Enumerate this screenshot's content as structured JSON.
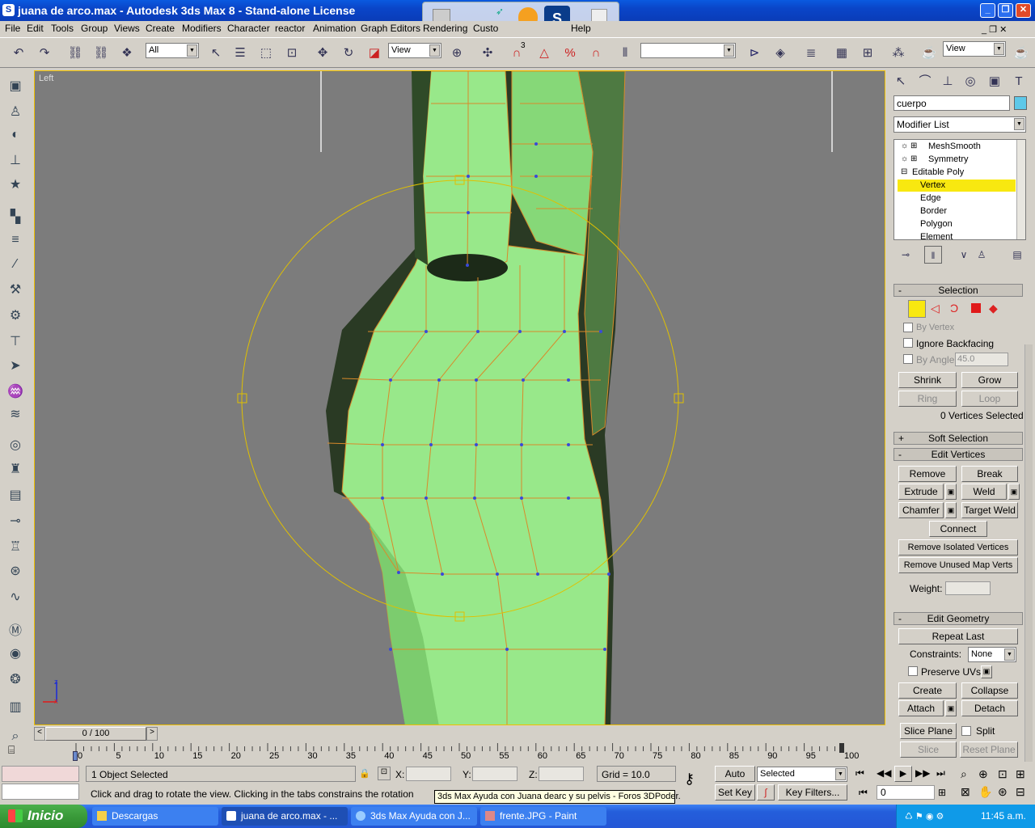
{
  "window": {
    "title": "juana de arco.max - Autodesk 3ds Max 8  - Stand-alone License"
  },
  "menu": [
    "File",
    "Edit",
    "Tools",
    "Group",
    "Views",
    "Create",
    "Modifiers",
    "Character",
    "reactor",
    "Animation",
    "Graph Editors",
    "Rendering",
    "Custo",
    "Help"
  ],
  "toolbar": {
    "selection_filter": "All",
    "ref_coord": "View",
    "named_sel": "",
    "view_combo": "View",
    "snap_angle": "3"
  },
  "viewport": {
    "label": "Left",
    "axis_z": "z",
    "axis_x": "x"
  },
  "command_panel": {
    "object_name": "cuerpo",
    "object_color": "#5ec8e8",
    "modifier_list_label": "Modifier List",
    "stack": [
      {
        "label": "MeshSmooth"
      },
      {
        "label": "Symmetry"
      },
      {
        "label": "Editable Poly"
      },
      {
        "label": "Vertex",
        "selected": true
      },
      {
        "label": "Edge"
      },
      {
        "label": "Border"
      },
      {
        "label": "Polygon"
      },
      {
        "label": "Element"
      }
    ],
    "selection": {
      "title": "Selection",
      "by_vertex": "By Vertex",
      "ignore_backfacing": "Ignore Backfacing",
      "by_angle": "By Angle:",
      "angle_value": "45.0",
      "shrink": "Shrink",
      "grow": "Grow",
      "ring": "Ring",
      "loop": "Loop",
      "status": "0 Vertices Selected"
    },
    "soft_selection": {
      "title": "Soft Selection"
    },
    "edit_vertices": {
      "title": "Edit Vertices",
      "remove": "Remove",
      "break": "Break",
      "extrude": "Extrude",
      "weld": "Weld",
      "chamfer": "Chamfer",
      "target_weld": "Target Weld",
      "connect": "Connect",
      "remove_isolated": "Remove Isolated Vertices",
      "remove_unused": "Remove Unused Map Verts",
      "weight_label": "Weight:"
    },
    "edit_geometry": {
      "title": "Edit Geometry",
      "repeat_last": "Repeat Last",
      "constraints_label": "Constraints:",
      "constraints_value": "None",
      "preserve_uvs": "Preserve UVs",
      "create": "Create",
      "collapse": "Collapse",
      "attach": "Attach",
      "detach": "Detach",
      "slice_plane": "Slice Plane",
      "split": "Split",
      "slice": "Slice",
      "reset_plane": "Reset Plane"
    }
  },
  "timeline": {
    "frame": "0 / 100",
    "ticks": [
      "0",
      "5",
      "10",
      "15",
      "20",
      "25",
      "30",
      "35",
      "40",
      "45",
      "50",
      "55",
      "60",
      "65",
      "70",
      "75",
      "80",
      "85",
      "90",
      "95",
      "100"
    ]
  },
  "status": {
    "objects": "1 Object Selected",
    "prompt": "Click and drag to rotate the view.  Clicking in the tabs constrains the rotation",
    "x_label": "X:",
    "y_label": "Y:",
    "z_label": "Z:",
    "grid": "Grid = 10.0",
    "auto_key": "Auto Key",
    "set_key": "Set Key",
    "selected": "Selected",
    "key_filters": "Key Filters...",
    "frame_value": "0"
  },
  "tooltip": "3ds Max Ayuda con Juana dearc y su pelvis - Foros 3DPoder.",
  "taskbar": {
    "start": "Inicio",
    "tasks": [
      "Descargas",
      "juana de arco.max - ...",
      "3ds Max Ayuda con J...",
      "frente.JPG - Paint"
    ],
    "clock": "11:45 a.m."
  }
}
